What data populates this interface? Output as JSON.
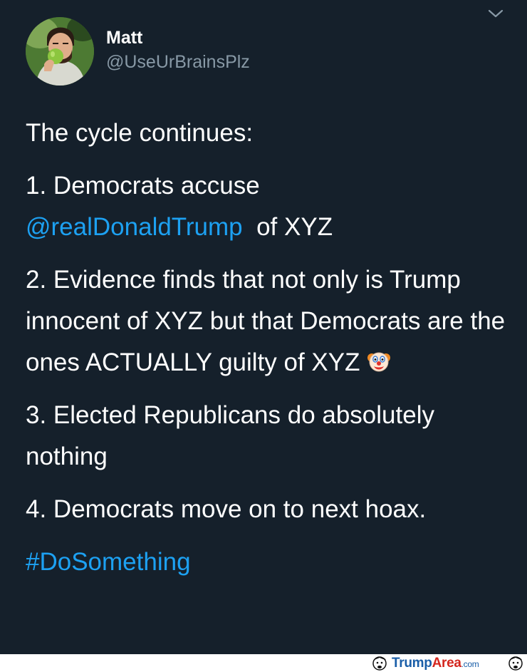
{
  "author": {
    "name": "Matt",
    "handle": "@UseUrBrainsPlz"
  },
  "menu": {
    "icon": "chevron-down-icon"
  },
  "tweet": {
    "intro": "The cycle continues:",
    "p1_start": "1. Democrats accuse",
    "p1_mention": "@realDonaldTrump",
    "p1_end": "of XYZ",
    "p2": "2. Evidence finds that not only is Trump innocent of XYZ but that Democrats are the ones ACTUALLY guilty of XYZ",
    "p2_emoji": "clown-face-icon",
    "p3": "3. Elected Republicans do absolutely nothing",
    "p4": "4. Democrats move on to next hoax.",
    "hashtag": "#DoSomething"
  },
  "watermark": {
    "part1": "Trump",
    "part2": "Area",
    "part3": ".com"
  },
  "colors": {
    "background": "#15202b",
    "text": "#ffffff",
    "secondary_text": "#8899a6",
    "link": "#1da1f2"
  }
}
